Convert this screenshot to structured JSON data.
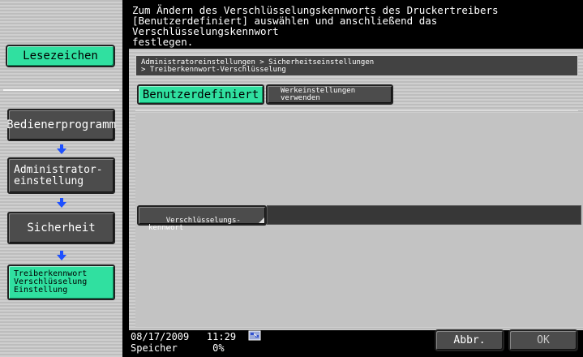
{
  "message": "Zum Ändern des Verschlüsselungskennworts des Druckertreibers\n[Benutzerdefiniert] auswählen und anschließend das Verschlüsselungskennwort\nfestlegen.",
  "sidebar": {
    "bookmark_label": "Lesezeichen",
    "steps": [
      {
        "label": "Bedienerprogramm"
      },
      {
        "label": "Administrator-\neinstellung"
      },
      {
        "label": "Sicherheit"
      },
      {
        "label": "Treiberkennwort\nVerschlüsselung\nEinstellung"
      }
    ]
  },
  "breadcrumb": "Administratoreinstellungen > Sicherheitseinstellungen\n> Treiberkennwort-Verschlüsselung",
  "tabs": {
    "user_defined": "Benutzerdefiniert",
    "factory": "Werkeinstellungen\nverwenden"
  },
  "password": {
    "label": "Verschlüsselungs-\nkennwort",
    "value": ""
  },
  "footer": {
    "datetime": "08/17/2009   11:29",
    "memory": "Speicher      0%",
    "cancel_label": "Abbr.",
    "ok_label": "OK"
  },
  "colors": {
    "active_green": "#30e0a0",
    "button_dark": "#4c4c4c",
    "panel_grey": "#c3c3c3",
    "arrow_blue": "#1e50ff"
  },
  "icons": [
    "arrow-down-icon",
    "network-icon"
  ]
}
